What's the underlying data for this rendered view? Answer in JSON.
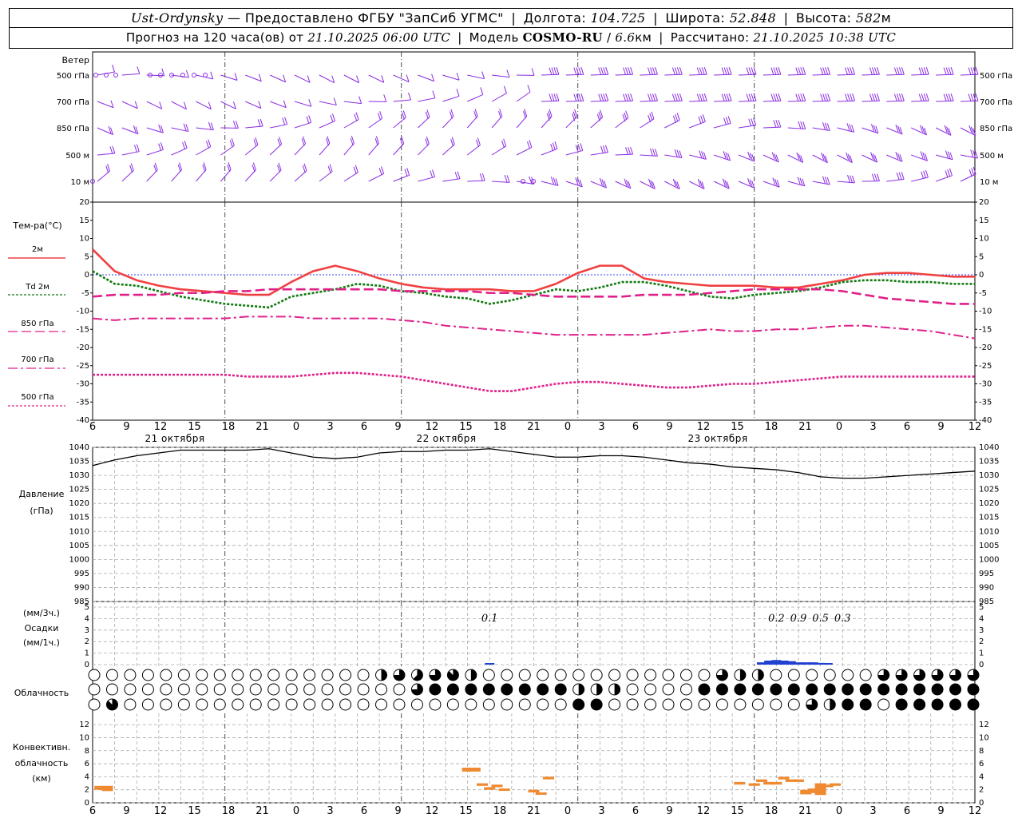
{
  "header": {
    "station": "Ust-Ordynsky",
    "provider": "— Предоставлено ФГБУ \"ЗапСиб УГМС\"",
    "lon_label": "Долгота:",
    "lon_value": "104.725",
    "lat_label": "Широта:",
    "lat_value": "52.848",
    "alt_label": "Высота:",
    "alt_value": "582",
    "alt_unit": "м",
    "forecast_label": "Прогноз на 120 часа(ов) от",
    "forecast_time": "21.10.2025 06:00 UTC",
    "model_label": "Модель",
    "model_name": "COSMO-RU",
    "model_res": "6.6",
    "model_res_unit": "км",
    "calc_label": "Рассчитано:",
    "calc_time": "21.10.2025 10:38 UTC"
  },
  "labels": {
    "wind_title": "Ветер",
    "wind_levels": [
      "500 гПа",
      "700 гПа",
      "850 гПа",
      "500 м",
      "10 м"
    ],
    "temp_title": "Тем-ра(°C)",
    "temp_legend": [
      "2м",
      "Td 2м",
      "850 гПа",
      "700 гПа",
      "500 гПа"
    ],
    "pressure_title": "Давление",
    "pressure_unit": "(гПа)",
    "precip_title_a": "(мм/3ч.)",
    "precip_title_b": "Осадки",
    "precip_title_c": "(мм/1ч.)",
    "cloud_title": "Облачность",
    "conv_title_a": "Конвективн.",
    "conv_title_b": "облачность",
    "conv_title_c": "(км)",
    "dates": [
      "21 октября",
      "22 октября",
      "23 октября"
    ]
  },
  "colors": {
    "t2m": "#f04040",
    "td2m": "#107810",
    "t850": "#e0208a",
    "t700": "#e0208a",
    "t500": "#e0208a",
    "zero_line": "#3040ff",
    "wind": "#8a2be2",
    "pressure": "#000000",
    "precip": "#2040d0",
    "convective": "#f08a30"
  },
  "chart_data": [
    {
      "type": "line",
      "panel": "temperature",
      "x_ticks": [
        "6",
        "9",
        "12",
        "15",
        "18",
        "21",
        "0",
        "3",
        "6",
        "9",
        "12",
        "15",
        "18",
        "21",
        "0",
        "3",
        "6",
        "9",
        "12",
        "15",
        "18",
        "21",
        "0",
        "3",
        "6",
        "9",
        "12"
      ],
      "x_hours": [
        6,
        9,
        12,
        15,
        18,
        21,
        24,
        27,
        30,
        33,
        36,
        39,
        42,
        45,
        48,
        51,
        54,
        57,
        60,
        63,
        66,
        69,
        72,
        75,
        78,
        81,
        84,
        87,
        90,
        93,
        96,
        99,
        102,
        105,
        108,
        111,
        114,
        117,
        120,
        123,
        126
      ],
      "ylim": [
        -40,
        20
      ],
      "y_ticks": [
        20,
        15,
        10,
        5,
        0,
        -5,
        -10,
        -15,
        -20,
        -25,
        -30,
        -35,
        -40
      ],
      "series": [
        {
          "name": "2м",
          "values": [
            7,
            1,
            -1.5,
            -3,
            -4,
            -4.5,
            -5,
            -5.5,
            -5.5,
            -2,
            1,
            2.5,
            1,
            -1,
            -2.5,
            -3.5,
            -4,
            -4,
            -4,
            -4.5,
            -4.5,
            -2.5,
            0.5,
            2.5,
            2.5,
            -1,
            -2,
            -2.5,
            -3,
            -3,
            -3,
            -3.5,
            -3.5,
            -2.5,
            -1.5,
            0,
            0.5,
            0.5,
            0,
            -0.5,
            -0.5
          ]
        },
        {
          "name": "Td 2м",
          "values": [
            1,
            -2.5,
            -3,
            -4.5,
            -6,
            -7,
            -8,
            -8.5,
            -9,
            -6,
            -5,
            -4,
            -2.5,
            -3,
            -4.5,
            -5,
            -6,
            -6.5,
            -8,
            -7,
            -5.5,
            -4,
            -4.5,
            -3.5,
            -2,
            -2,
            -3,
            -4.5,
            -6,
            -6.5,
            -5.5,
            -5,
            -4.5,
            -3.5,
            -2,
            -1.5,
            -1.5,
            -2,
            -2,
            -2.5,
            -2.5
          ]
        },
        {
          "name": "850 гПа",
          "values": [
            -6,
            -5.5,
            -5.5,
            -5.5,
            -5,
            -5,
            -4.5,
            -4.5,
            -4,
            -4,
            -4,
            -4,
            -4,
            -4,
            -4.5,
            -4.5,
            -4.5,
            -4.5,
            -5,
            -5,
            -5.5,
            -6,
            -6,
            -6,
            -6,
            -5.5,
            -5.5,
            -5.5,
            -5,
            -4.5,
            -4,
            -4,
            -4,
            -4,
            -4.5,
            -5.5,
            -6.5,
            -7,
            -7.5,
            -8,
            -8
          ]
        },
        {
          "name": "700 гПа",
          "values": [
            -12,
            -12.5,
            -12,
            -12,
            -12,
            -12,
            -12,
            -11.5,
            -11.5,
            -11.5,
            -12,
            -12,
            -12,
            -12,
            -12.5,
            -13,
            -14,
            -14.5,
            -15,
            -15.5,
            -16,
            -16.5,
            -16.5,
            -16.5,
            -16.5,
            -16.5,
            -16,
            -15.5,
            -15,
            -15.5,
            -15.5,
            -15,
            -15,
            -14.5,
            -14,
            -14,
            -14.5,
            -15,
            -15.5,
            -16.5,
            -17.5
          ]
        },
        {
          "name": "500 гПа",
          "values": [
            -27.5,
            -27.5,
            -27.5,
            -27.5,
            -27.5,
            -27.5,
            -27.5,
            -28,
            -28,
            -28,
            -27.5,
            -27,
            -27,
            -27.5,
            -28,
            -29,
            -30,
            -31,
            -32,
            -32,
            -31,
            -30,
            -29.5,
            -29.5,
            -30,
            -30.5,
            -31,
            -31,
            -30.5,
            -30,
            -30,
            -29.5,
            -29,
            -28.5,
            -28,
            -28,
            -28,
            -28,
            -28,
            -28,
            -28
          ]
        }
      ]
    },
    {
      "type": "line",
      "panel": "pressure",
      "x_hours": [
        6,
        9,
        12,
        15,
        18,
        21,
        24,
        27,
        30,
        33,
        36,
        39,
        42,
        45,
        48,
        51,
        54,
        57,
        60,
        63,
        66,
        69,
        72,
        75,
        78,
        81,
        84,
        87,
        90,
        93,
        96,
        99,
        102,
        105,
        108,
        111,
        114,
        117,
        120,
        123,
        126
      ],
      "ylim": [
        985,
        1040
      ],
      "y_ticks": [
        1040,
        1035,
        1030,
        1025,
        1020,
        1015,
        1010,
        1005,
        1000,
        995,
        990,
        985
      ],
      "series": [
        {
          "name": "",
          "values": [
            1033.5,
            1035.5,
            1037,
            1038,
            1039,
            1039,
            1039,
            1039,
            1039.5,
            1038,
            1036.5,
            1036,
            1036.5,
            1038,
            1038.5,
            1038.5,
            1039,
            1039,
            1039.5,
            1038.5,
            1037.5,
            1036.5,
            1036.5,
            1037,
            1037,
            1036.5,
            1035.5,
            1034.5,
            1034,
            1033,
            1032.5,
            1032,
            1031,
            1029.5,
            1029,
            1029,
            1029.5,
            1030,
            1030.5,
            1031,
            1031.5
          ]
        }
      ]
    },
    {
      "type": "bar",
      "panel": "precipitation",
      "ylim": [
        0,
        5
      ],
      "y_ticks": [
        5,
        4,
        3,
        2,
        1,
        0
      ],
      "labels_3h": [
        {
          "hour": 60,
          "text": "0.1"
        },
        {
          "hour": 99,
          "text": "0.2"
        },
        {
          "hour": 102,
          "text": "0.9"
        },
        {
          "hour": 105,
          "text": "0.5"
        },
        {
          "hour": 108,
          "text": "0.3"
        }
      ],
      "bars_1h": [
        {
          "hour": 60,
          "value": 0.1
        },
        {
          "hour": 97,
          "value": 0.2
        },
        {
          "hour": 98,
          "value": 0.35
        },
        {
          "hour": 99,
          "value": 0.4
        },
        {
          "hour": 100,
          "value": 0.35
        },
        {
          "hour": 101,
          "value": 0.3
        },
        {
          "hour": 102,
          "value": 0.2
        },
        {
          "hour": 103,
          "value": 0.2
        },
        {
          "hour": 104,
          "value": 0.2
        },
        {
          "hour": 105,
          "value": 0.15
        },
        {
          "hour": 106,
          "value": 0.1
        }
      ]
    },
    {
      "type": "bar",
      "panel": "convective",
      "ylim": [
        0,
        12
      ],
      "y_ticks": [
        12,
        10,
        8,
        6,
        4,
        2,
        0
      ],
      "segments": [
        {
          "hour": 7,
          "base": 2,
          "top": 2.6
        },
        {
          "hour": 8,
          "base": 1.8,
          "top": 2.6
        },
        {
          "hour": 57,
          "base": 4.8,
          "top": 5.4
        },
        {
          "hour": 58,
          "base": 4.8,
          "top": 5.4
        },
        {
          "hour": 59,
          "base": 2.6,
          "top": 3
        },
        {
          "hour": 60,
          "base": 2,
          "top": 2.4
        },
        {
          "hour": 61,
          "base": 2.4,
          "top": 2.8
        },
        {
          "hour": 62,
          "base": 1.9,
          "top": 2.2
        },
        {
          "hour": 66,
          "base": 1.6,
          "top": 2
        },
        {
          "hour": 67,
          "base": 1.3,
          "top": 1.6
        },
        {
          "hour": 68,
          "base": 3.6,
          "top": 4
        },
        {
          "hour": 94,
          "base": 2.8,
          "top": 3.2
        },
        {
          "hour": 96,
          "base": 2.6,
          "top": 3
        },
        {
          "hour": 97,
          "base": 3.2,
          "top": 3.6
        },
        {
          "hour": 98,
          "base": 2.8,
          "top": 3.2
        },
        {
          "hour": 99,
          "base": 2.8,
          "top": 3.2
        },
        {
          "hour": 100,
          "base": 3.6,
          "top": 4
        },
        {
          "hour": 101,
          "base": 3.2,
          "top": 3.6
        },
        {
          "hour": 102,
          "base": 3.2,
          "top": 3.6
        },
        {
          "hour": 103,
          "base": 1.3,
          "top": 2
        },
        {
          "hour": 104,
          "base": 1.5,
          "top": 2.2
        },
        {
          "hour": 105,
          "base": 1.2,
          "top": 3
        },
        {
          "hour": 106,
          "base": 2.4,
          "top": 2.8
        },
        {
          "hour": 107,
          "base": 2.6,
          "top": 3
        }
      ]
    },
    {
      "type": "table",
      "panel": "cloudiness",
      "rows": [
        {
          "name": "upper",
          "cover_octets": [
            0,
            0,
            0,
            0,
            0,
            0,
            0,
            0,
            0,
            0,
            0,
            0,
            0,
            0,
            0,
            0,
            0,
            0,
            0,
            0,
            0,
            0,
            0,
            0,
            0,
            0,
            0,
            0,
            0,
            0,
            0,
            0,
            0,
            0,
            0,
            0,
            0,
            0,
            0,
            0,
            0,
            4,
            6,
            6,
            6,
            6,
            5,
            5,
            5,
            6,
            6,
            7,
            7,
            6,
            4,
            4,
            0,
            0,
            0,
            0,
            0,
            0,
            0,
            0,
            0,
            0,
            0,
            0,
            0,
            0,
            0,
            0,
            0,
            0,
            0,
            0,
            0,
            0,
            0,
            0,
            0,
            0,
            0,
            0,
            0,
            0,
            0,
            0,
            0,
            0,
            0,
            6,
            4,
            4,
            4,
            4,
            4,
            0,
            0,
            0,
            0,
            0,
            0,
            0,
            0,
            0,
            0,
            0,
            0,
            0,
            0,
            0,
            0,
            4,
            6,
            6,
            6,
            6,
            6,
            6,
            6,
            6,
            6,
            6,
            6,
            6,
            6,
            6,
            6,
            6,
            6
          ]
        },
        {
          "name": "middle",
          "cover_octets": [
            0,
            0,
            0,
            0,
            0,
            0,
            0,
            0,
            0,
            0,
            0,
            0,
            0,
            0,
            0,
            0,
            0,
            0,
            0,
            0,
            0,
            0,
            0,
            0,
            0,
            0,
            0,
            0,
            0,
            0,
            0,
            0,
            0,
            0,
            0,
            0,
            0,
            0,
            0,
            0,
            0,
            0,
            0,
            0,
            0,
            0,
            4,
            8,
            6,
            8,
            8,
            8,
            8,
            8,
            8,
            8,
            8,
            8,
            8,
            8,
            8,
            8,
            8,
            8,
            8,
            8,
            8,
            8,
            8,
            8,
            8,
            8,
            4,
            4,
            4,
            4,
            4,
            4,
            4,
            4,
            0,
            0,
            0,
            0,
            0,
            0,
            0,
            0,
            0,
            0,
            8,
            8,
            8,
            8,
            8,
            8,
            8,
            8,
            8,
            8,
            8,
            8,
            8,
            8,
            8,
            8,
            8,
            8,
            8,
            8,
            8,
            8,
            8,
            8,
            8,
            8,
            8,
            8,
            8,
            8,
            8,
            8,
            8,
            8,
            8,
            8,
            8,
            8,
            8,
            8,
            8,
            8,
            8,
            8
          ]
        },
        {
          "name": "lower",
          "cover_octets": [
            0,
            4,
            7,
            0,
            0,
            0,
            0,
            0,
            0,
            0,
            0,
            0,
            0,
            0,
            0,
            0,
            0,
            0,
            0,
            0,
            0,
            0,
            0,
            0,
            0,
            0,
            0,
            0,
            0,
            0,
            0,
            0,
            0,
            0,
            0,
            0,
            0,
            0,
            0,
            0,
            0,
            0,
            0,
            0,
            0,
            0,
            0,
            0,
            4,
            0,
            0,
            0,
            0,
            0,
            0,
            0,
            0,
            0,
            0,
            6,
            0,
            0,
            0,
            0,
            0,
            0,
            0,
            0,
            0,
            0,
            0,
            0,
            0,
            8,
            8,
            8,
            8,
            8,
            0,
            0,
            0,
            0,
            0,
            0,
            0,
            0,
            0,
            0,
            0,
            0,
            0,
            0,
            0,
            0,
            0,
            0,
            0,
            0,
            0,
            0,
            0,
            0,
            0,
            0,
            0,
            0,
            0,
            0,
            8,
            6,
            4,
            4,
            4,
            4,
            6,
            8,
            8,
            8,
            6,
            0,
            0,
            0,
            0,
            8,
            8,
            8,
            8,
            8,
            8,
            8,
            8,
            8,
            8,
            8,
            8,
            8,
            8
          ]
        }
      ]
    }
  ]
}
